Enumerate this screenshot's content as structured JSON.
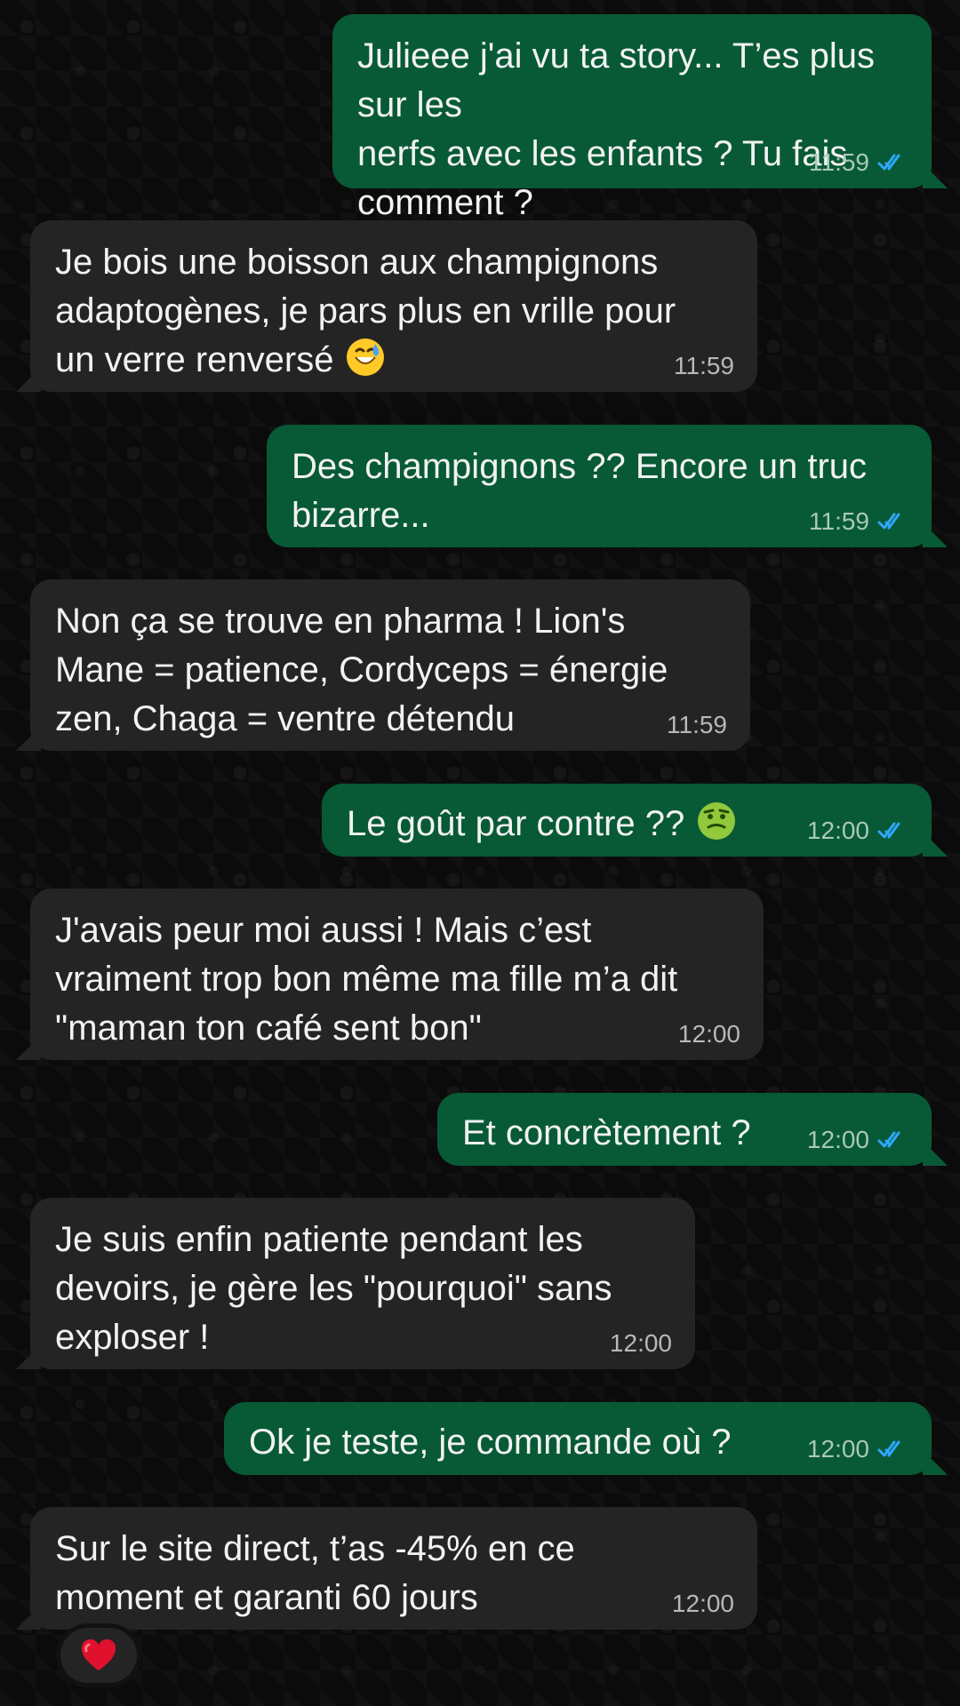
{
  "conversation": {
    "messages": [
      {
        "direction": "sent",
        "text": "Julieee j'ai vu ta story... T’es plus sur les\nnerfs avec les enfants ? Tu fais\ncomment ?",
        "time": "11:59",
        "status": "read",
        "icon": "double-check-icon"
      },
      {
        "direction": "received",
        "text": "Je bois une boisson aux champignons\nadaptogènes, je pars plus en vrille pour\nun verre renversé",
        "emoji": "😅",
        "time": "11:59"
      },
      {
        "direction": "sent",
        "text": "Des champignons ?? Encore un truc\nbizarre...",
        "time": "11:59",
        "status": "read",
        "icon": "double-check-icon"
      },
      {
        "direction": "received",
        "text": "Non ça se trouve en pharma ! Lion's\nMane = patience, Cordyceps = énergie\nzen, Chaga = ventre détendu",
        "time": "11:59"
      },
      {
        "direction": "sent",
        "text": "Le goût par contre ??",
        "emoji": "🤢",
        "time": "12:00",
        "status": "read",
        "icon": "double-check-icon"
      },
      {
        "direction": "received",
        "text": "J'avais peur moi aussi ! Mais c’est\nvraiment trop bon même ma fille m’a dit\n\"maman ton café sent bon\"",
        "time": "12:00"
      },
      {
        "direction": "sent",
        "text": "Et concrètement ?",
        "time": "12:00",
        "status": "read",
        "icon": "double-check-icon"
      },
      {
        "direction": "received",
        "text": "Je suis enfin patiente pendant les\ndevoirs, je gère les \"pourquoi\" sans\nexploser !",
        "time": "12:00"
      },
      {
        "direction": "sent",
        "text": "Ok je teste, je commande où ?",
        "time": "12:00",
        "status": "read",
        "icon": "double-check-icon"
      },
      {
        "direction": "received",
        "text": "Sur le site direct, t’as -45% en ce\nmoment et garanti 60 jours",
        "time": "12:00",
        "reaction": "❤️"
      }
    ]
  },
  "colors": {
    "background": "#0b0b0b",
    "sent_bubble": "#075a35",
    "received_bubble": "#242424",
    "text": "#f2f2f2",
    "read_checks": "#2ea8ff"
  }
}
